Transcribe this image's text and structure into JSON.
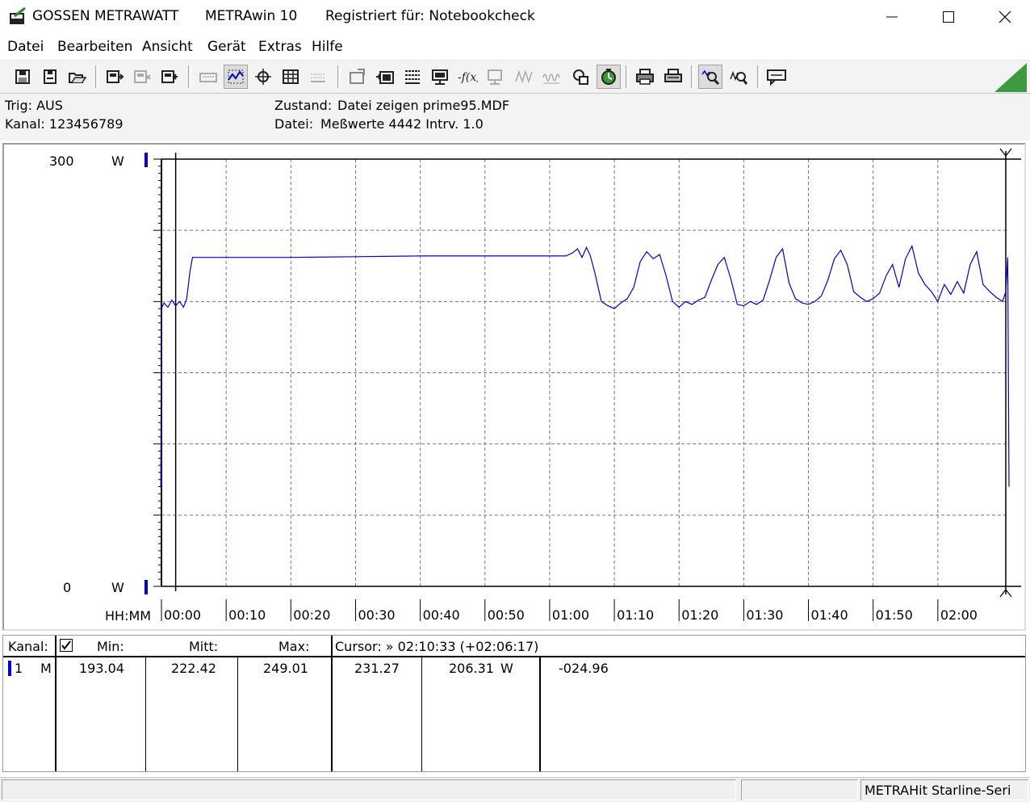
{
  "titlebar": {
    "company": "GOSSEN METRAWATT",
    "app_name": "METRAwin 10",
    "registered": "Registriert für: Notebookcheck",
    "icon": "meter-icon"
  },
  "menu": [
    "Datei",
    "Bearbeiten",
    "Ansicht",
    "Gerät",
    "Extras",
    "Hilfe"
  ],
  "info": {
    "trig": "Trig: AUS",
    "kanal": "Kanal: 123456789",
    "zustand_label": "Zustand:",
    "zustand_value": "Datei zeigen prime95.MDF",
    "datei_label": "Datei:",
    "datei_value": "Meßwerte 4442   Intrv. 1.0"
  },
  "chart_data": {
    "type": "line",
    "title": "",
    "xlabel": "HH:MM",
    "ylabel": "W",
    "y_top_label": "300",
    "y_bottom_label": "0",
    "y_unit": "W",
    "ylim": [
      0,
      300
    ],
    "xlim_minutes": [
      0,
      131
    ],
    "grid": true,
    "x_ticks": [
      "00:00",
      "00:10",
      "00:20",
      "00:30",
      "00:40",
      "00:50",
      "01:00",
      "01:10",
      "01:20",
      "01:30",
      "01:40",
      "01:50",
      "02:00"
    ],
    "cursor_minutes": 130.5,
    "series": [
      {
        "color": "#0000d0",
        "points": [
          [
            -0.1,
            70
          ],
          [
            0,
            195
          ],
          [
            0.4,
            199
          ],
          [
            1,
            196
          ],
          [
            1.6,
            201
          ],
          [
            2.2,
            197
          ],
          [
            2.8,
            200
          ],
          [
            3.4,
            196
          ],
          [
            3.9,
            202
          ],
          [
            4.4,
            221
          ],
          [
            4.8,
            231
          ],
          [
            10,
            231
          ],
          [
            20,
            231
          ],
          [
            30,
            231.5
          ],
          [
            40,
            232
          ],
          [
            50,
            232
          ],
          [
            62.5,
            232
          ],
          [
            63.5,
            234
          ],
          [
            64.3,
            237
          ],
          [
            65,
            231
          ],
          [
            65.7,
            238
          ],
          [
            66.3,
            232
          ],
          [
            67,
            220
          ],
          [
            68,
            200
          ],
          [
            69,
            197
          ],
          [
            70,
            195
          ],
          [
            71,
            199
          ],
          [
            72,
            202
          ],
          [
            73,
            210
          ],
          [
            74,
            228
          ],
          [
            75,
            235
          ],
          [
            76,
            230
          ],
          [
            77,
            233
          ],
          [
            78,
            218
          ],
          [
            79,
            200
          ],
          [
            80,
            196
          ],
          [
            81,
            200
          ],
          [
            82,
            198
          ],
          [
            83,
            201
          ],
          [
            84,
            203
          ],
          [
            85,
            215
          ],
          [
            86,
            226
          ],
          [
            87,
            231
          ],
          [
            88,
            216
          ],
          [
            89,
            198
          ],
          [
            90,
            197
          ],
          [
            91,
            200
          ],
          [
            92,
            198
          ],
          [
            93,
            201
          ],
          [
            94,
            215
          ],
          [
            95,
            231
          ],
          [
            96,
            237
          ],
          [
            97,
            213
          ],
          [
            98,
            202
          ],
          [
            99,
            199
          ],
          [
            100,
            198
          ],
          [
            101,
            200
          ],
          [
            102,
            204
          ],
          [
            103,
            215
          ],
          [
            104,
            230
          ],
          [
            105,
            236
          ],
          [
            106,
            226
          ],
          [
            107,
            207
          ],
          [
            108,
            203
          ],
          [
            109,
            200
          ],
          [
            110,
            202
          ],
          [
            111,
            206
          ],
          [
            112,
            218
          ],
          [
            113,
            226
          ],
          [
            114,
            210
          ],
          [
            115,
            230
          ],
          [
            116,
            239
          ],
          [
            117,
            220
          ],
          [
            118,
            212
          ],
          [
            119,
            207
          ],
          [
            120,
            200
          ],
          [
            121,
            212
          ],
          [
            122,
            205
          ],
          [
            123,
            214
          ],
          [
            124,
            206
          ],
          [
            125,
            226
          ],
          [
            126,
            235
          ],
          [
            127,
            212
          ],
          [
            128,
            207
          ],
          [
            129,
            203
          ],
          [
            130,
            200
          ],
          [
            130.5,
            207
          ],
          [
            130.8,
            231
          ],
          [
            131,
            70
          ]
        ]
      }
    ]
  },
  "table": {
    "kanal_label": "Kanal:",
    "min_label": "Min:",
    "mitt_label": "Mitt:",
    "max_label": "Max:",
    "cursor_label": "Cursor: » 02:10:33 (+02:06:17)",
    "row": {
      "channel": "1",
      "mode": "M",
      "min": "193.04",
      "mitt": "222.42",
      "max": "249.01",
      "cursor_value": "231.27",
      "value2": "206.31",
      "unit": "W",
      "diff": "-024.96"
    }
  },
  "status": {
    "device": "METRAHit Starline-Seri"
  },
  "toolbar_icons": [
    "save-icon",
    "save-as-icon",
    "open-icon",
    "device-icon",
    "device-off-icon",
    "device-read-icon",
    "keyboard-icon",
    "zoom-area-icon",
    "crosshair-icon",
    "table-icon",
    "grid-icon",
    "export-icon",
    "import-icon",
    "settings-icon",
    "monitor-icon",
    "formula-icon",
    "display-icon",
    "wave-icon",
    "wave2-icon",
    "copy-icon",
    "timer-icon",
    "print-icon",
    "print-setup-icon",
    "zoom-in-icon",
    "zoom-out-icon",
    "chat-icon"
  ]
}
